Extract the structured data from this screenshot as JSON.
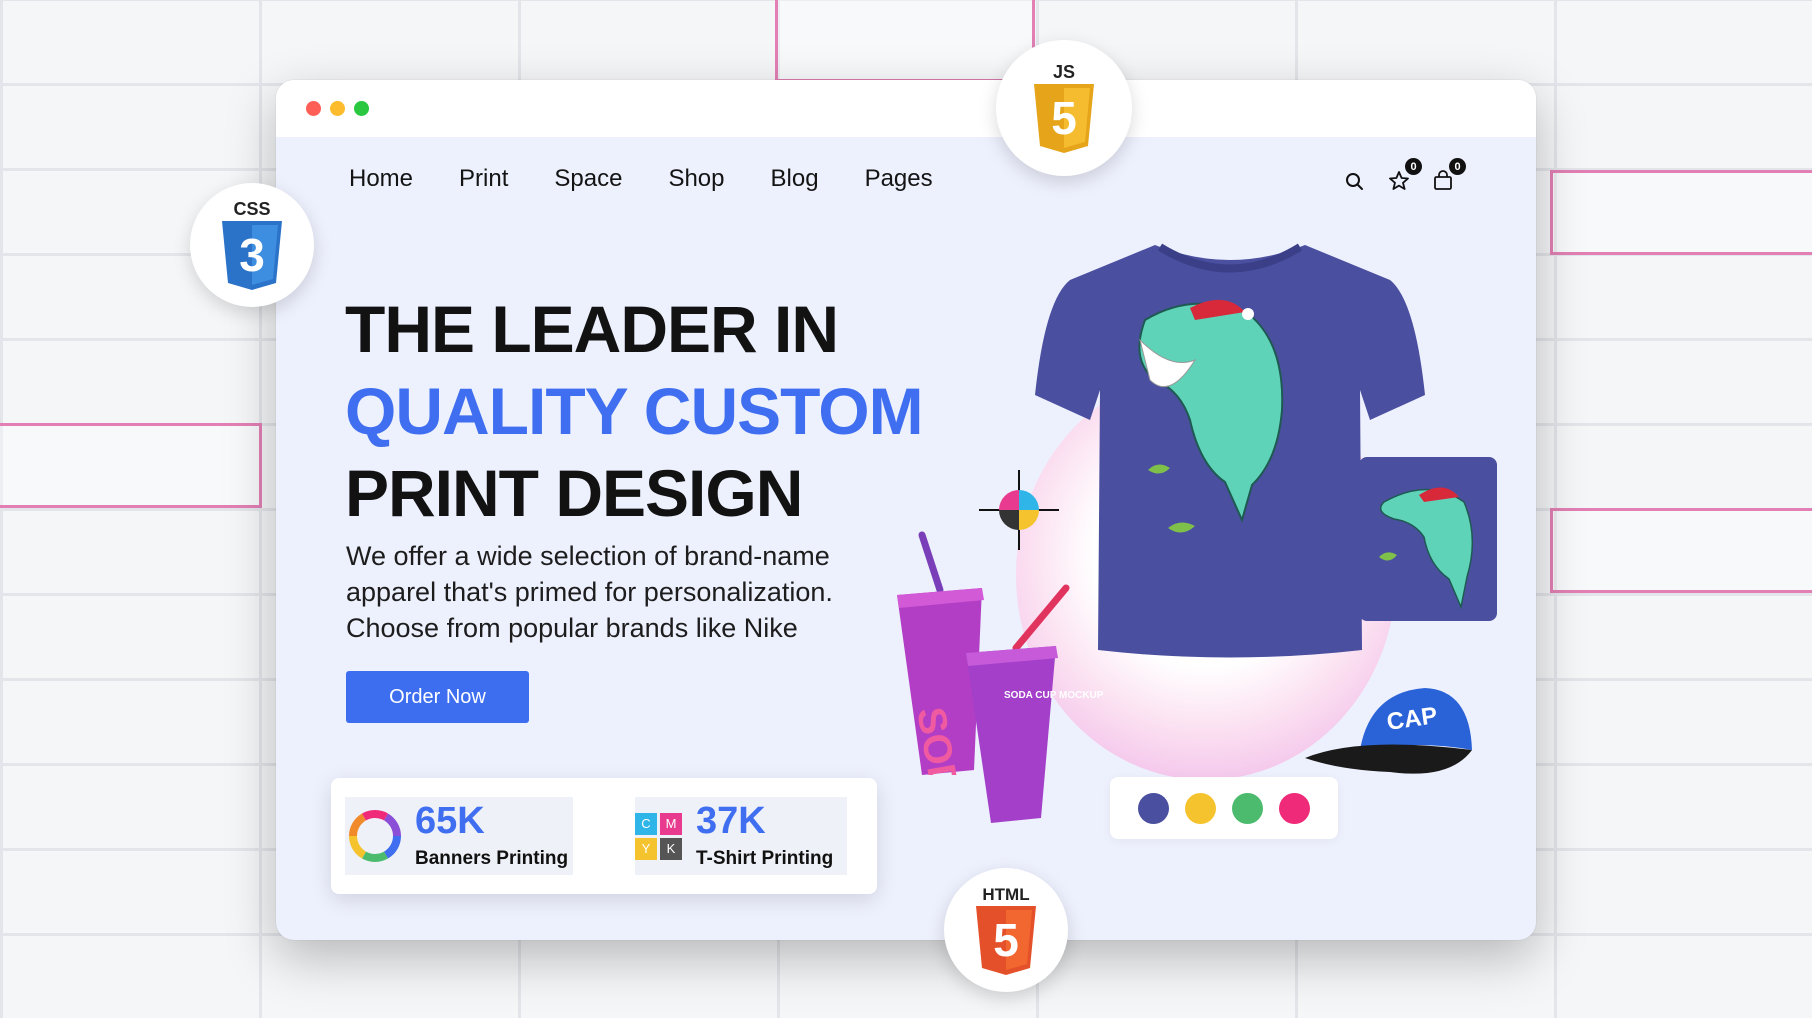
{
  "nav": {
    "items": [
      {
        "label": "Home"
      },
      {
        "label": "Print"
      },
      {
        "label": "Space"
      },
      {
        "label": "Shop"
      },
      {
        "label": "Blog"
      },
      {
        "label": "Pages"
      }
    ],
    "wishlist_count": "0",
    "cart_count": "0",
    "icons": [
      "search-icon",
      "star-icon",
      "bag-icon"
    ]
  },
  "hero": {
    "line1": "THE LEADER IN",
    "line2": "QUALITY CUSTOM",
    "line3": "PRINT DESIGN",
    "description": "We offer a wide selection of brand-name apparel that's primed for personalization. Choose from popular brands like Nike",
    "cta_label": "Order Now"
  },
  "stats": [
    {
      "value": "65K",
      "label": "Banners Printing",
      "icon": "color-wheel-icon"
    },
    {
      "value": "37K",
      "label": "T-Shirt Printing",
      "icon": "cmyk-icon"
    }
  ],
  "cmyk_letters": [
    "C",
    "M",
    "Y",
    "K"
  ],
  "products": {
    "cup_text": "SODA CUP MOCKUP",
    "cup_logo": "SODA",
    "cap_text": "CAP"
  },
  "color_swatches": [
    "#4a4f9f",
    "#f4c32e",
    "#4cbb6e",
    "#ef2a78"
  ],
  "tech_badges": [
    {
      "label": "CSS",
      "number": "3",
      "color": "#2a73c9"
    },
    {
      "label": "JS",
      "number": "5",
      "color": "#efb521"
    },
    {
      "label": "HTML",
      "number": "5",
      "color": "#ea5a29"
    }
  ],
  "colors": {
    "accent": "#3f6ff0",
    "window_bg": "#edf0fd",
    "traffic_red": "#fd5f57",
    "traffic_yellow": "#fcbc2e",
    "traffic_green": "#29c840"
  }
}
